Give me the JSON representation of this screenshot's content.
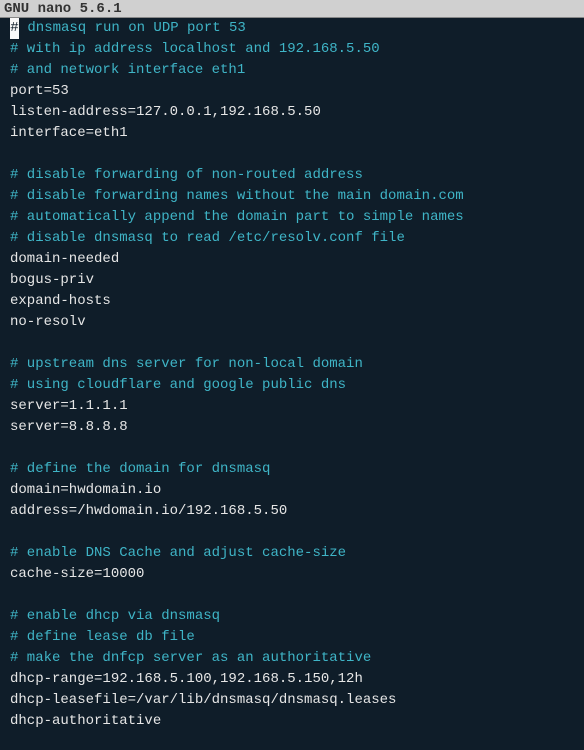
{
  "title": "  GNU nano 5.6.1",
  "lines": [
    {
      "prefix_cursor": true,
      "comment": " dnsmasq run on UDP port 53"
    },
    {
      "comment": "# with ip address localhost and 192.168.5.50"
    },
    {
      "comment": "# and network interface eth1"
    },
    {
      "plain": "port=53"
    },
    {
      "plain": "listen-address=127.0.0.1,192.168.5.50"
    },
    {
      "plain": "interface=eth1"
    },
    {
      "blank": true
    },
    {
      "comment": "# disable forwarding of non-routed address"
    },
    {
      "comment": "# disable forwarding names without the main domain.com"
    },
    {
      "comment": "# automatically append the domain part to simple names"
    },
    {
      "comment": "# disable dnsmasq to read /etc/resolv.conf file"
    },
    {
      "plain": "domain-needed"
    },
    {
      "plain": "bogus-priv"
    },
    {
      "plain": "expand-hosts"
    },
    {
      "plain": "no-resolv"
    },
    {
      "blank": true
    },
    {
      "comment": "# upstream dns server for non-local domain"
    },
    {
      "comment": "# using cloudflare and google public dns"
    },
    {
      "plain": "server=1.1.1.1"
    },
    {
      "plain": "server=8.8.8.8"
    },
    {
      "blank": true
    },
    {
      "comment": "# define the domain for dnsmasq"
    },
    {
      "plain": "domain=hwdomain.io"
    },
    {
      "plain": "address=/hwdomain.io/192.168.5.50"
    },
    {
      "blank": true
    },
    {
      "comment": "# enable DNS Cache and adjust cache-size"
    },
    {
      "plain": "cache-size=10000"
    },
    {
      "blank": true
    },
    {
      "comment": "# enable dhcp via dnsmasq"
    },
    {
      "comment": "# define lease db file"
    },
    {
      "comment": "# make the dnfcp server as an authoritative"
    },
    {
      "plain": "dhcp-range=192.168.5.100,192.168.5.150,12h"
    },
    {
      "plain": "dhcp-leasefile=/var/lib/dnsmasq/dnsmasq.leases"
    },
    {
      "plain": "dhcp-authoritative"
    }
  ],
  "cursor_char": "#"
}
